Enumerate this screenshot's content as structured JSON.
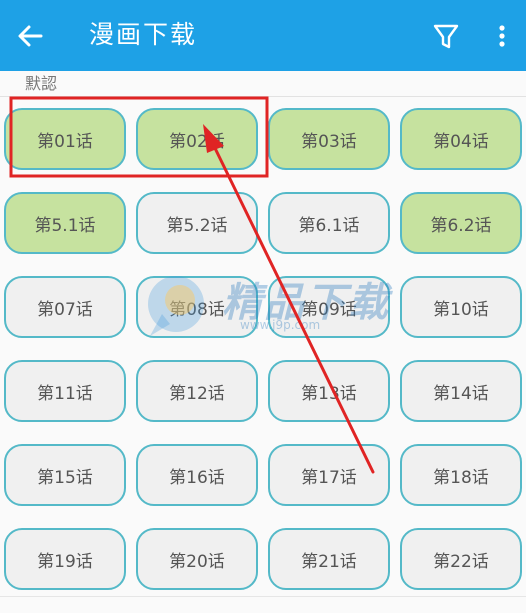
{
  "appbar": {
    "title": "漫画下载",
    "back_icon": "arrow-left-icon",
    "filter_icon": "filter-icon",
    "more_icon": "more-vertical-icon"
  },
  "section": {
    "label": "默認"
  },
  "chapters": [
    {
      "label": "第01话",
      "done": true
    },
    {
      "label": "第02话",
      "done": true
    },
    {
      "label": "第03话",
      "done": true
    },
    {
      "label": "第04话",
      "done": true
    },
    {
      "label": "第5.1话",
      "done": true
    },
    {
      "label": "第5.2话",
      "done": false
    },
    {
      "label": "第6.1话",
      "done": false
    },
    {
      "label": "第6.2话",
      "done": true
    },
    {
      "label": "第07话",
      "done": false
    },
    {
      "label": "第08话",
      "done": false
    },
    {
      "label": "第09话",
      "done": false
    },
    {
      "label": "第10话",
      "done": false
    },
    {
      "label": "第11话",
      "done": false
    },
    {
      "label": "第12话",
      "done": false
    },
    {
      "label": "第13话",
      "done": false
    },
    {
      "label": "第14话",
      "done": false
    },
    {
      "label": "第15话",
      "done": false
    },
    {
      "label": "第16话",
      "done": false
    },
    {
      "label": "第17话",
      "done": false
    },
    {
      "label": "第18话",
      "done": false
    },
    {
      "label": "第19话",
      "done": false
    },
    {
      "label": "第20话",
      "done": false
    },
    {
      "label": "第21话",
      "done": false
    },
    {
      "label": "第22话",
      "done": false
    }
  ],
  "watermark": {
    "text": "精品下载",
    "url": "www.j9p.com"
  },
  "colors": {
    "appbar": "#1ea1e6",
    "chip_border": "#54b9c8",
    "chip_done": "#c6e29f",
    "chip_default": "#f0f0f0",
    "annotation": "#e02424"
  }
}
